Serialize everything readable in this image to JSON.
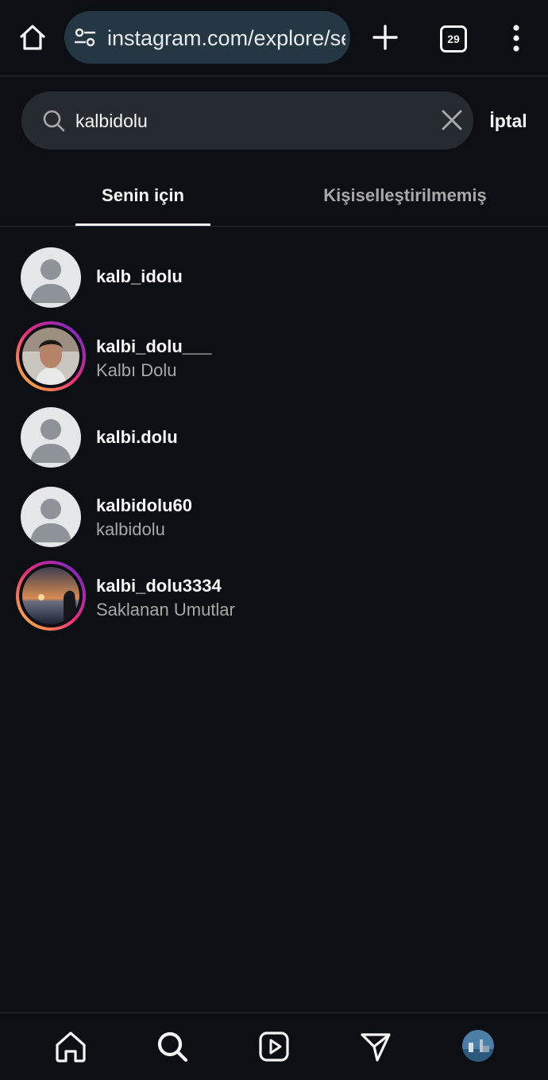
{
  "browser": {
    "url": "instagram.com/explore/search/",
    "tab_count": "29"
  },
  "search": {
    "query": "kalbidolu",
    "cancel_label": "İptal"
  },
  "tabs": [
    {
      "label": "Senin için",
      "active": true
    },
    {
      "label": "Kişiselleştirilmemiş",
      "active": false
    }
  ],
  "results": [
    {
      "username": "kalb_idolu",
      "full_name": "",
      "avatar": "default-avatar",
      "story_ring": false
    },
    {
      "username": "kalbi_dolu___",
      "full_name": "Kalbı Dolu",
      "avatar": "man-photo",
      "story_ring": true
    },
    {
      "username": "kalbi.dolu",
      "full_name": "",
      "avatar": "default-avatar",
      "story_ring": false
    },
    {
      "username": "kalbidolu60",
      "full_name": "kalbidolu",
      "avatar": "default-avatar",
      "story_ring": false
    },
    {
      "username": "kalbi_dolu3334",
      "full_name": "Saklanan Umutlar",
      "avatar": "sunset-photo",
      "story_ring": true
    }
  ],
  "colors": {
    "background": "#0c1014",
    "search_field": "#262b31",
    "url_field": "#243743",
    "secondary_text": "#a8a8a8",
    "story_ring": [
      "#f9ce34",
      "#ee2a7b",
      "#6228d7"
    ]
  },
  "bottom_nav": [
    "home-icon",
    "search-icon",
    "reels-icon",
    "direct-icon",
    "profile-avatar"
  ]
}
